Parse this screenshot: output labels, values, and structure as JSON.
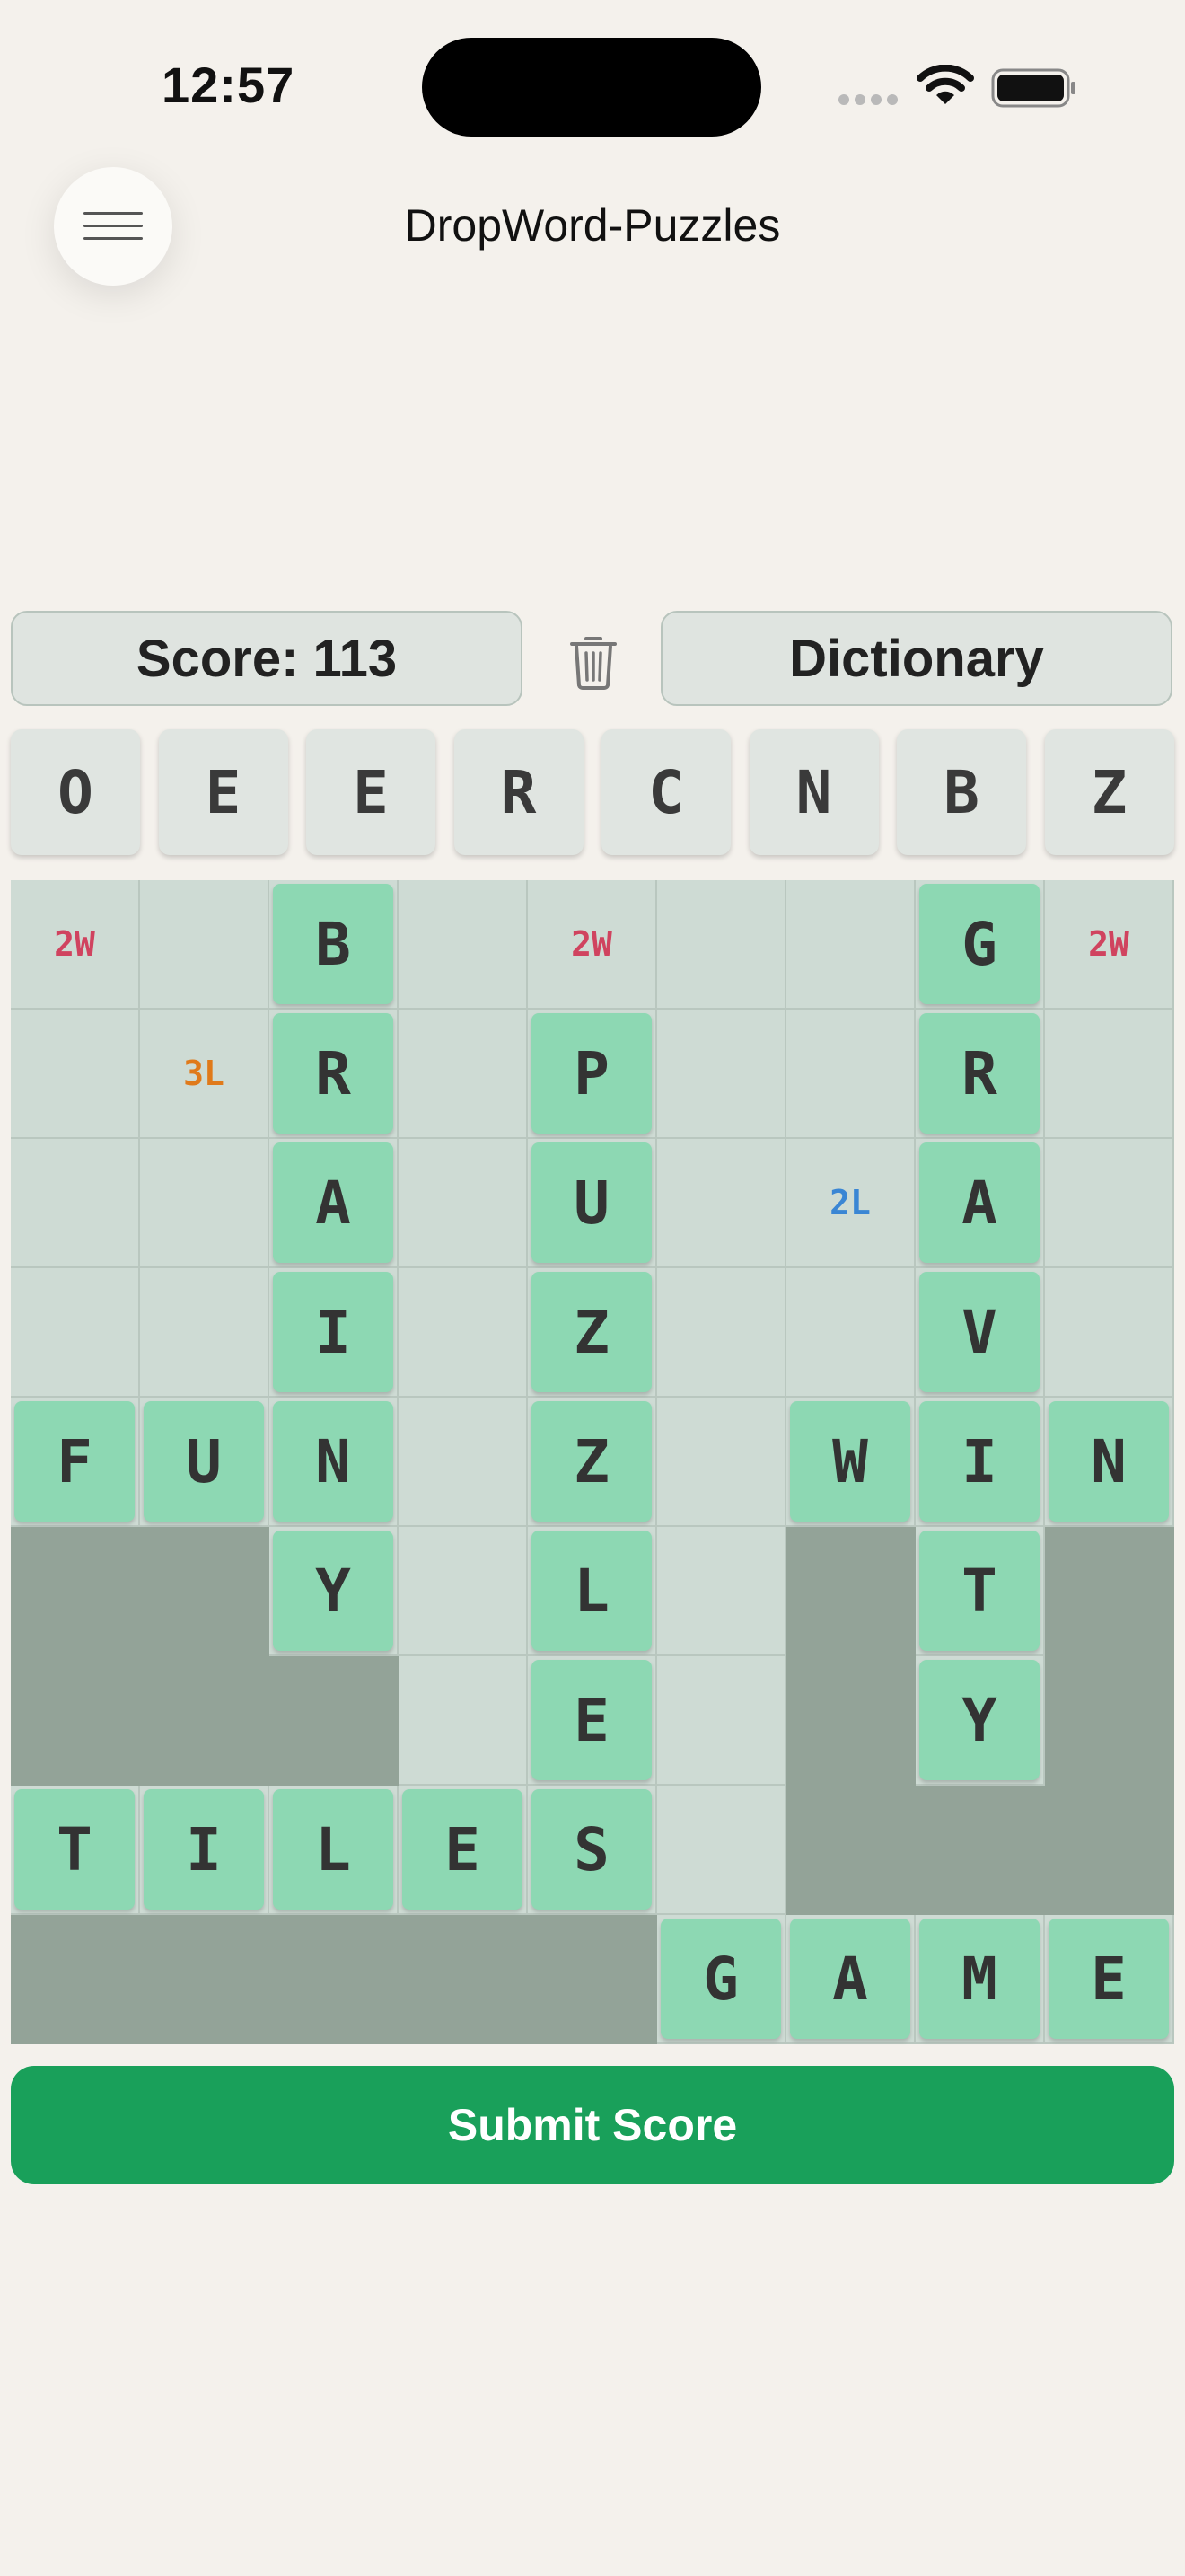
{
  "status_bar": {
    "time": "12:57"
  },
  "header": {
    "title": "DropWord-Puzzles"
  },
  "controls": {
    "score_label": "Score: 113",
    "dictionary_label": "Dictionary"
  },
  "rack": [
    "O",
    "E",
    "E",
    "R",
    "C",
    "N",
    "B",
    "Z"
  ],
  "board": {
    "rows": [
      [
        {
          "b": "2W",
          "c": "#d0435f"
        },
        {},
        {
          "l": "B"
        },
        {},
        {
          "b": "2W",
          "c": "#d0435f"
        },
        {},
        {},
        {
          "l": "G"
        },
        {
          "b": "2W",
          "c": "#d0435f"
        }
      ],
      [
        {},
        {
          "b": "3L",
          "c": "#e07a1a"
        },
        {
          "l": "R"
        },
        {},
        {
          "l": "P"
        },
        {},
        {},
        {
          "l": "R"
        },
        {}
      ],
      [
        {},
        {},
        {
          "l": "A"
        },
        {},
        {
          "l": "U"
        },
        {},
        {
          "b": "2L",
          "c": "#3a86d4"
        },
        {
          "l": "A"
        },
        {}
      ],
      [
        {},
        {},
        {
          "l": "I"
        },
        {},
        {
          "l": "Z"
        },
        {},
        {},
        {
          "l": "V"
        },
        {}
      ],
      [
        {
          "l": "F"
        },
        {
          "l": "U"
        },
        {
          "l": "N"
        },
        {},
        {
          "l": "Z"
        },
        {},
        {
          "l": "W"
        },
        {
          "l": "I"
        },
        {
          "l": "N"
        }
      ],
      [
        {
          "x": 1
        },
        {
          "x": 1
        },
        {
          "l": "Y"
        },
        {},
        {
          "l": "L"
        },
        {},
        {
          "x": 1
        },
        {
          "l": "T"
        },
        {
          "x": 1
        }
      ],
      [
        {
          "x": 1
        },
        {
          "x": 1
        },
        {
          "x": 1
        },
        {},
        {
          "l": "E"
        },
        {},
        {
          "x": 1
        },
        {
          "l": "Y"
        },
        {
          "x": 1
        }
      ],
      [
        {
          "l": "T"
        },
        {
          "l": "I"
        },
        {
          "l": "L"
        },
        {
          "l": "E"
        },
        {
          "l": "S"
        },
        {},
        {
          "x": 1
        },
        {
          "x": 1
        },
        {
          "x": 1
        }
      ],
      [
        {
          "x": 1
        },
        {
          "x": 1
        },
        {
          "x": 1
        },
        {
          "x": 1
        },
        {
          "x": 1
        },
        {
          "l": "G"
        },
        {
          "l": "A"
        },
        {
          "l": "M"
        },
        {
          "l": "E"
        }
      ]
    ]
  },
  "submit": {
    "label": "Submit Score"
  },
  "colors": {
    "accent": "#19a05a",
    "tile": "#8dd8b3",
    "bonus_2w": "#d0435f",
    "bonus_3l": "#e07a1a",
    "bonus_2l": "#3a86d4"
  },
  "icons": {
    "menu": "hamburger-icon",
    "trash": "trash-icon",
    "wifi": "wifi-icon",
    "battery": "battery-icon",
    "signal": "signal-icon"
  }
}
